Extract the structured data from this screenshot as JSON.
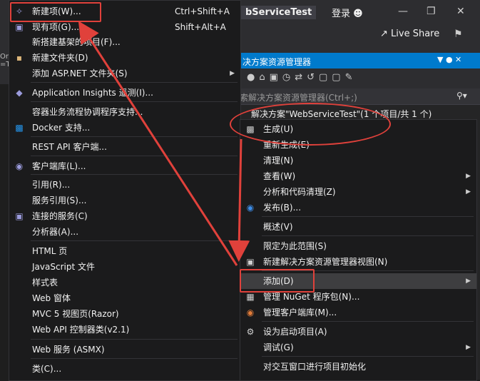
{
  "titlebar": {
    "title": "bServiceTest",
    "signin": "登录",
    "live_share": "Live Share"
  },
  "left_tab": {
    "label": "Or\n=T"
  },
  "solution_explorer": {
    "title": "决方案资源管理器",
    "search_placeholder": "索解决方案资源管理器(Ctrl+;)",
    "root": "解决方案\"WebServiceTest\"(1 个项目/共 1 个)"
  },
  "add_menu": {
    "items": [
      {
        "label": "新建项(W)...",
        "shortcut": "Ctrl+Shift+A"
      },
      {
        "label": "现有项(G)...",
        "shortcut": "Shift+Alt+A"
      },
      {
        "label": "新搭建基架的项目(F)..."
      },
      {
        "label": "新建文件夹(D)"
      },
      {
        "label": "添加 ASP.NET 文件夹(S)",
        "submenu": true
      },
      {
        "label": "Application Insights 遥测(I)..."
      },
      {
        "label": "容器业务流程协调程序支持..."
      },
      {
        "label": "Docker 支持..."
      },
      {
        "label": "REST API 客户端..."
      },
      {
        "label": "客户端库(L)..."
      },
      {
        "label": "引用(R)..."
      },
      {
        "label": "服务引用(S)..."
      },
      {
        "label": "连接的服务(C)"
      },
      {
        "label": "分析器(A)..."
      },
      {
        "label": "HTML 页"
      },
      {
        "label": "JavaScript 文件"
      },
      {
        "label": "样式表"
      },
      {
        "label": "Web 窗体"
      },
      {
        "label": "MVC 5 视图页(Razor)"
      },
      {
        "label": "Web API 控制器类(v2.1)"
      },
      {
        "label": "Web 服务 (ASMX)"
      },
      {
        "label": "类(C)..."
      }
    ]
  },
  "context_menu": {
    "items": [
      {
        "label": "生成(U)"
      },
      {
        "label": "重新生成(E)"
      },
      {
        "label": "清理(N)"
      },
      {
        "label": "查看(W)",
        "submenu": true
      },
      {
        "label": "分析和代码清理(Z)",
        "submenu": true
      },
      {
        "label": "发布(B)..."
      },
      {
        "label": "概述(V)"
      },
      {
        "label": "限定为此范围(S)"
      },
      {
        "label": "新建解决方案资源管理器视图(N)"
      },
      {
        "label": "添加(D)",
        "submenu": true
      },
      {
        "label": "管理 NuGet 程序包(N)..."
      },
      {
        "label": "管理客户端库(M)..."
      },
      {
        "label": "设为启动项目(A)"
      },
      {
        "label": "调试(G)",
        "submenu": true
      },
      {
        "label": "对交互窗口进行项目初始化"
      }
    ]
  },
  "colors": {
    "accent": "#007acc",
    "annotation": "#e0413b",
    "menu_bg": "#1b1b1c"
  },
  "icons": {
    "new_item": "new-item-icon",
    "existing_item": "existing-item-icon",
    "folder": "folder-icon",
    "app_insights": "app-insights-icon",
    "docker": "docker-icon",
    "client_library": "client-library-icon",
    "connected_service": "connected-service-icon",
    "build": "build-icon",
    "publish": "globe-icon",
    "new_view": "new-view-icon",
    "nuget": "nuget-icon",
    "manage_lib": "manage-library-icon",
    "settings": "gear-icon"
  }
}
